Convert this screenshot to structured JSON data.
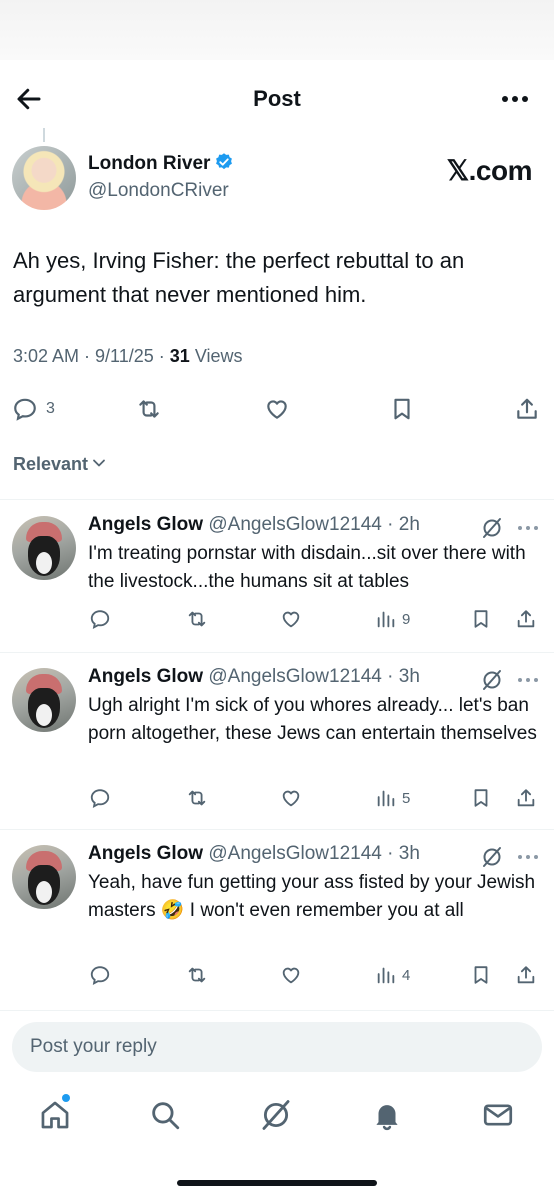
{
  "header": {
    "title": "Post"
  },
  "author": {
    "name": "London River",
    "handle": "@LondonCRiver",
    "watermark": "𝕏.com"
  },
  "post": {
    "text": "Ah yes, Irving Fisher: the perfect rebuttal to an argument that never mentioned him.",
    "time": "3:02 AM",
    "date": "9/11/25",
    "views_count": "31",
    "views_label": "Views",
    "reply_count": "3"
  },
  "sort": {
    "label": "Relevant"
  },
  "replies": [
    {
      "name": "Angels Glow",
      "handle": "@AngelsGlow12144",
      "age": "2h",
      "text": "I'm treating pornstar with disdain...sit over there with the livestock...the humans sit at tables",
      "views": "9"
    },
    {
      "name": "Angels Glow",
      "handle": "@AngelsGlow12144",
      "age": "3h",
      "text": "Ugh alright I'm sick of you whores already... let's ban porn altogether, these Jews can entertain themselves",
      "views": "5"
    },
    {
      "name": "Angels Glow",
      "handle": "@AngelsGlow12144",
      "age": "3h",
      "text": "Yeah, have fun getting your ass fisted by your Jewish masters 🤣 I won't even remember you at all",
      "views": "4"
    }
  ],
  "compose": {
    "placeholder": "Post your reply"
  },
  "colors": {
    "accent": "#1d9bf0",
    "text": "#0f1419",
    "muted": "#536471"
  }
}
